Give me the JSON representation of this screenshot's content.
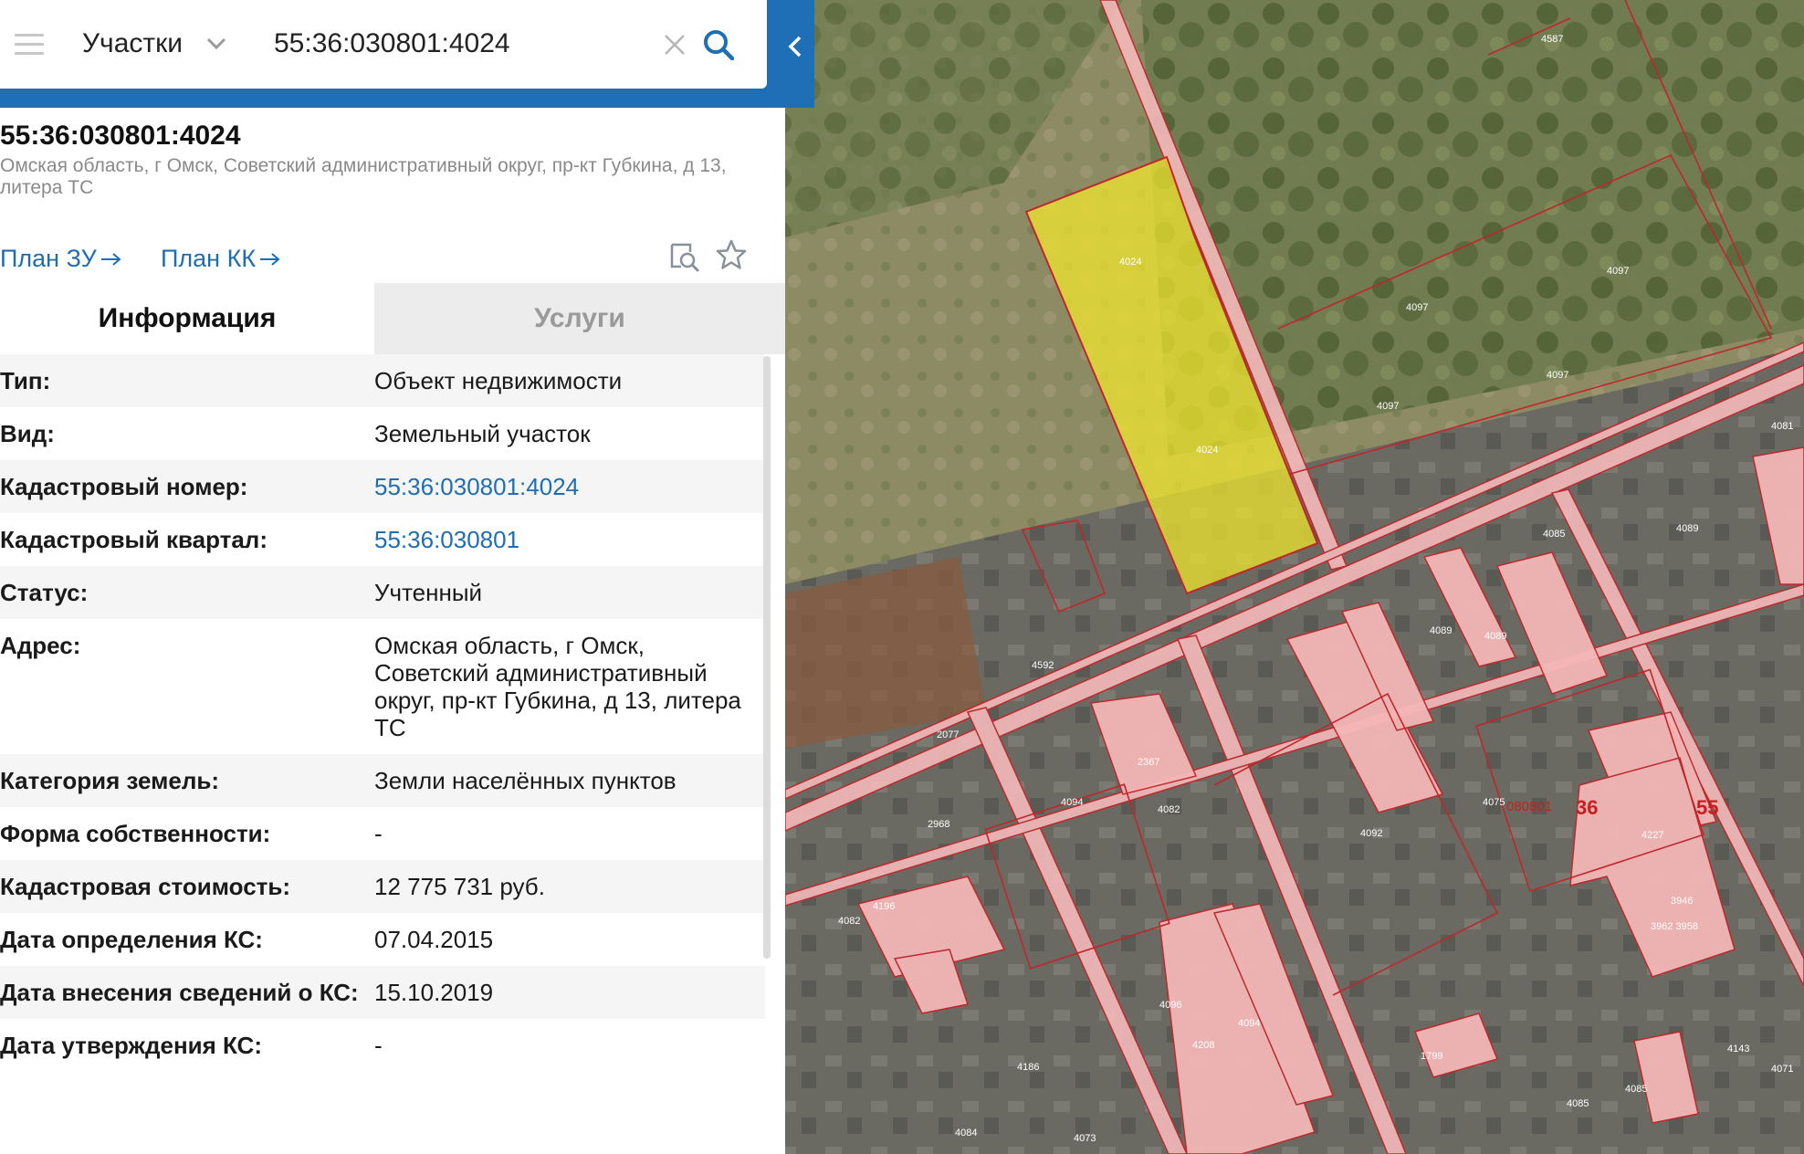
{
  "search": {
    "type_label": "Участки",
    "query": "55:36:030801:4024"
  },
  "object": {
    "title": "55:36:030801:4024",
    "address_line": "Омская область, г Омск, Советский административный округ, пр-кт Губкина, д 13, литера ТС",
    "links": {
      "plan_zu": "План ЗУ",
      "plan_kk": "План КК"
    }
  },
  "tabs": {
    "info": "Информация",
    "services": "Услуги"
  },
  "info_rows": [
    {
      "key": "Тип:",
      "value": "Объект недвижимости",
      "link": false
    },
    {
      "key": "Вид:",
      "value": "Земельный участок",
      "link": false
    },
    {
      "key": "Кадастровый номер:",
      "value": "55:36:030801:4024",
      "link": true
    },
    {
      "key": "Кадастровый квартал:",
      "value": "55:36:030801",
      "link": true
    },
    {
      "key": "Статус:",
      "value": "Учтенный",
      "link": false
    },
    {
      "key": "Адрес:",
      "value": "Омская область, г Омск, Советский административный округ, пр-кт Губкина, д 13, литера ТС",
      "link": false
    },
    {
      "key": "Категория земель:",
      "value": "Земли населённых пунктов",
      "link": false
    },
    {
      "key": "Форма собственности:",
      "value": "-",
      "link": false
    },
    {
      "key": "Кадастровая стоимость:",
      "value": "12 775 731 руб.",
      "link": false
    },
    {
      "key": "Дата определения КС:",
      "value": "07.04.2015",
      "link": false
    },
    {
      "key": "Дата внесения сведений о КС:",
      "value": "15.10.2019",
      "link": false
    },
    {
      "key": "Дата утверждения КС:",
      "value": "-",
      "link": false
    }
  ],
  "map": {
    "highlight_color": "#f0e62d",
    "parcel_color": "#f4b6b6",
    "boundary_color": "#c0262a",
    "parcel_labels": [
      "4587",
      "4024",
      "4024",
      "4097",
      "4097",
      "4097",
      "4097",
      "4081",
      "4085",
      "4089",
      "4089",
      "4089",
      "4092",
      "4082",
      "2367",
      "4094",
      "4082",
      "4075",
      "4227",
      "3946",
      "3962 3958",
      "4096",
      "4094",
      "4208",
      "1799",
      "4186",
      "4073",
      "4084",
      "4085",
      "4085",
      "4143",
      "4071",
      "4592",
      "2077",
      "2968",
      "4196"
    ],
    "quarter_labels": {
      "q1": "080801",
      "q2": "36",
      "q3": "55"
    }
  }
}
